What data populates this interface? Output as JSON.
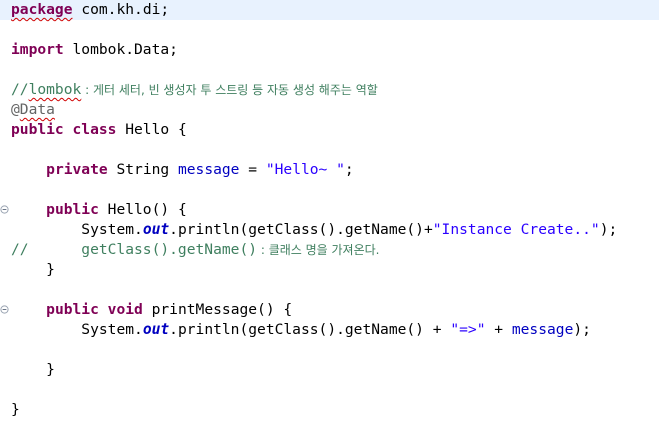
{
  "code": {
    "package_kw": "package",
    "package_name": "com.kh.di",
    "semicolon": ";",
    "import_kw": "import",
    "import_name": "lombok.Data",
    "comment_prefix": "//",
    "comment_lombok": "lombok",
    "comment_korean": " : 게터 세터, 빈 생성자 투 스트링 등 자동 생성 해주는 역할",
    "annotation_at": "@",
    "annotation_name": "Data",
    "public_kw": "public",
    "class_kw": "class",
    "class_name": " Hello {",
    "private_kw": "private",
    "field_type": " String ",
    "field_name": "message",
    "assign": " = ",
    "field_value": "\"Hello~ \"",
    "ctor_sig": " Hello() {",
    "sysout_prefix": "System.",
    "out_field": "out",
    "println_ctor": ".println(getClass().getName()+",
    "ctor_string": "\"Instance Create..\"",
    "ctor_close": ");",
    "commented_line": "//      getClass().getName()",
    "commented_korean": " : 클래스 명을 가져온다.",
    "close_brace": "}",
    "void_kw": "void",
    "method_sig": " printMessage() {",
    "println_msg": ".println(getClass().getName() + ",
    "arrow_string": "\"=>\"",
    "plus": " + ",
    "msg_close": ");"
  }
}
